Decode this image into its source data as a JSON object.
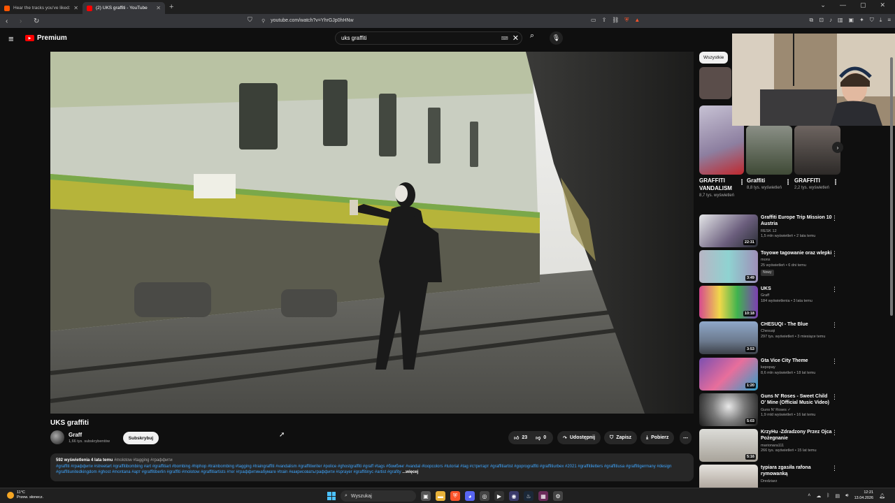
{
  "browser": {
    "tabs": [
      {
        "title": "Hear the tracks you've liked: on Sou",
        "favicon_color": "#ff5500",
        "active": false
      },
      {
        "title": "(2) UKS graffiti - YouTube",
        "favicon_color": "#ff0000",
        "active": true
      }
    ],
    "url": "youtube.com/watch?v=YhrGJp0hHNw"
  },
  "youtube": {
    "logo_text": "Premium",
    "search_query": "uks graffiti",
    "video": {
      "title": "UKS graffiti",
      "channel": "Graff",
      "subscribers": "1,66 tys. subskrybentów",
      "subscribe_label": "Subskrybuj",
      "likes": "23",
      "dislikes": "0",
      "share_label": "Udostępnij",
      "save_label": "Zapisz",
      "download_label": "Pobierz"
    },
    "description": {
      "views": "592 wyświetlenia",
      "date": "4 lata temu",
      "tags_top": "#molotow #tagging #граффити",
      "hashtags": "#graffiti #граффити #streetart #graffitibombing #art #graffitiart #bombing #hiphop #trainbombing #tagging #traingraffiti #vandalism #graffitiwriter #police #ghostgraffiti #graff #tags #бомбинг #vandal #loopcolors #tutorial #tag #стритарт #graffitiartist #goprograffiti #graffitiurbex #2021 #graffitiletters #graffitiusa #graffitigermany #design #graffitiunitedkingdom #ghost #montana #арт #graffitiberlin #graffiti #molotow #graffitiartists #тег #граффитинабумаге #train #какрисоватьграффити #sprayer #graffitinyc #artist #grafity",
      "more": "...więcej"
    },
    "chip_all": "Wszystkie",
    "shorts": [
      {
        "title": "GRAFFITI VANDALISM",
        "views": "8,7 tys. wyświetleń"
      },
      {
        "title": "Graffiti",
        "views": "8,8 tys. wyświetleń"
      },
      {
        "title": "GRAFFITI",
        "views": "2,2 tys. wyświetleń"
      }
    ],
    "recommendations": [
      {
        "title": "Graffiti Europe Trip Mission 10 Austria",
        "channel": "RESK 12",
        "meta": "1,5 mln wyświetleń • 2 lata temu",
        "duration": "22:31",
        "badge": ""
      },
      {
        "title": "Toyowe tagowanie oraz wlepki",
        "channel": "monx",
        "meta": "25 wyświetleń • 6 dni temu",
        "duration": "3:49",
        "badge": "Nowy"
      },
      {
        "title": "UKS",
        "channel": "Graff",
        "meta": "184 wyświetlenia • 3 lata temu",
        "duration": "10:18",
        "badge": ""
      },
      {
        "title": "CHESUQI - The Blue",
        "channel": "Chesuqi",
        "meta": "297 tys. wyświetleń • 3 miesiące temu",
        "duration": "3:53",
        "badge": ""
      },
      {
        "title": "Gta Vice City Theme",
        "channel": "kepopay",
        "meta": "8,6 mln wyświetleń • 18 lat temu",
        "duration": "1:20",
        "badge": ""
      },
      {
        "title": "Guns N' Roses - Sweet Child O' Mine (Official Music Video)",
        "channel": "Guns N' Roses ✓",
        "meta": "1,9 mld wyświetleń • 16 lat temu",
        "duration": "5:03",
        "badge": ""
      },
      {
        "title": "KrzyHu -Zdradzony Przez Ojca Pożegnanie",
        "channel": "marionara111",
        "meta": "266 tys. wyświetleń • 15 lat temu",
        "duration": "5:16",
        "badge": ""
      },
      {
        "title": "typiara zgasiła rafona rymowanką",
        "channel": "Dredziarz",
        "meta": "",
        "duration": "",
        "badge": ""
      }
    ]
  },
  "taskbar": {
    "temperature": "11°C",
    "weather": "Przew. słonecz.",
    "search_placeholder": "Wyszukaj",
    "time": "12:21",
    "date": "13.04.2026"
  },
  "colors": {
    "accent": "#ff0000",
    "link": "#3ea6ff",
    "background": "#0f0f0f"
  }
}
